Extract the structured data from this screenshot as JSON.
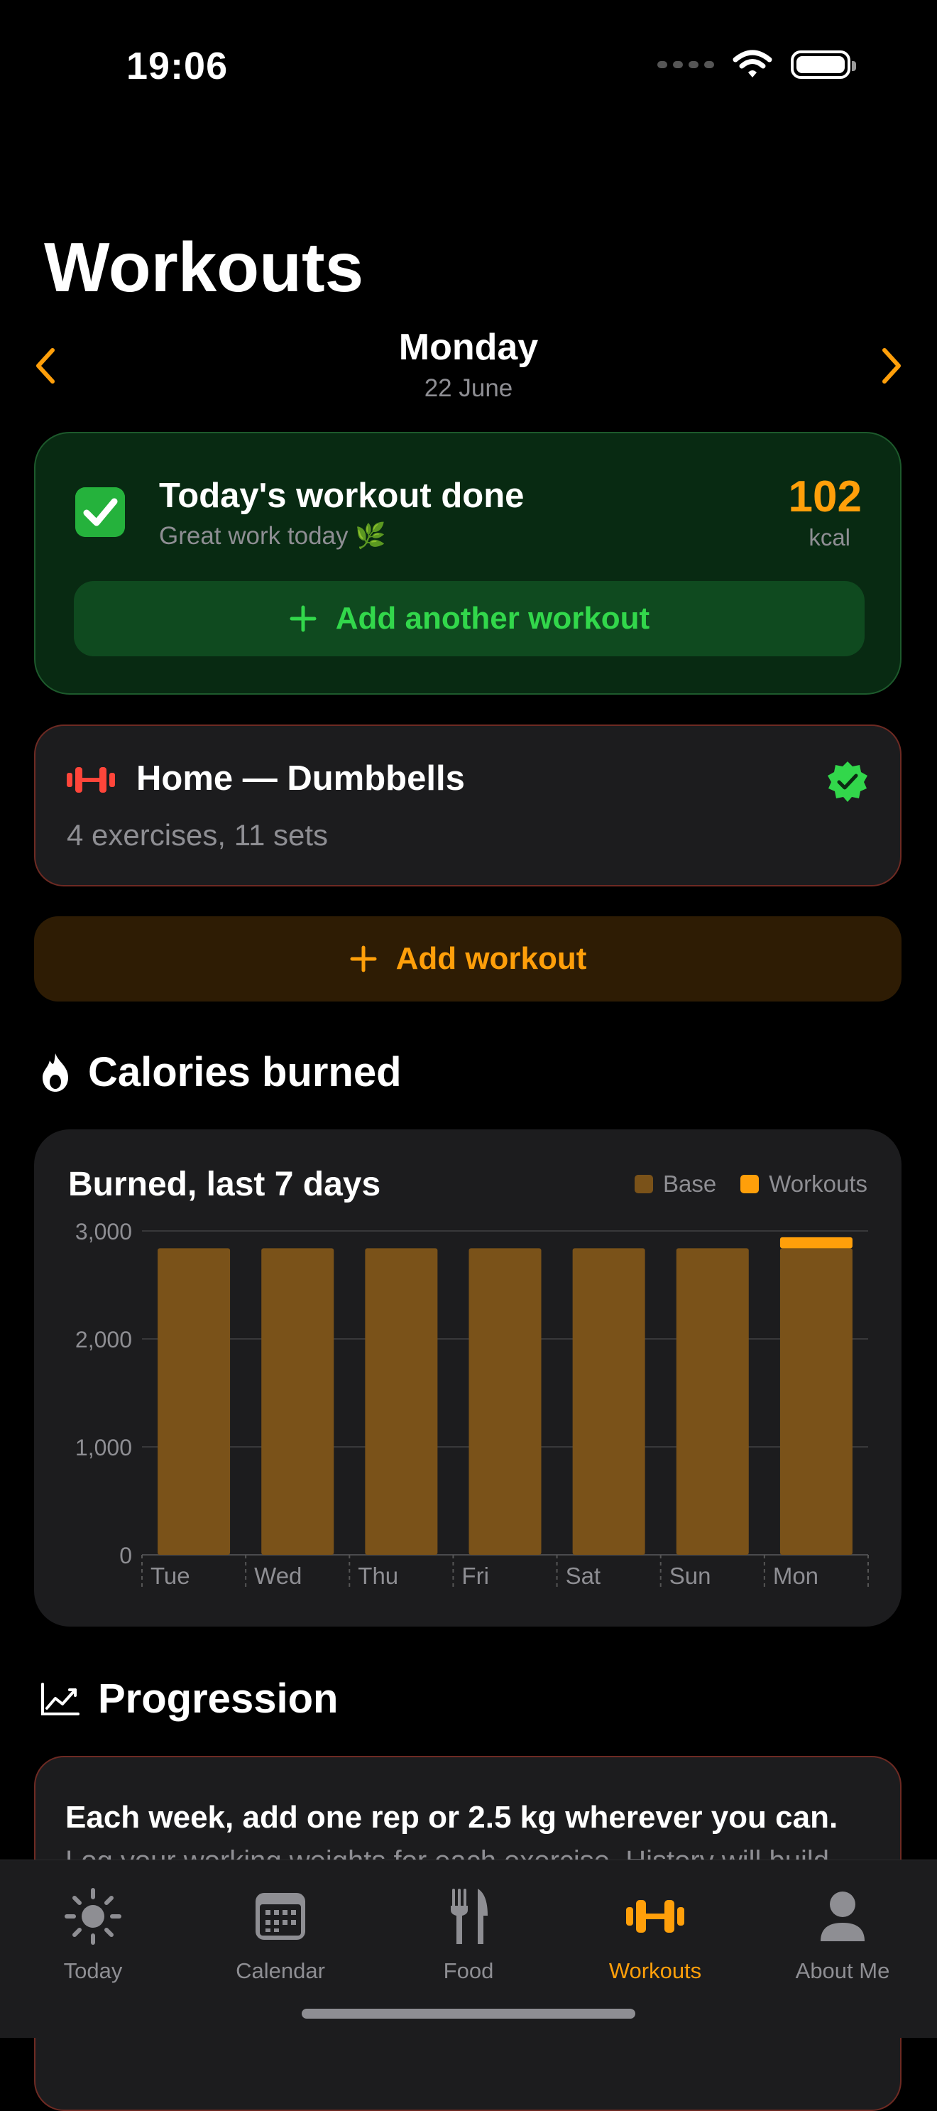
{
  "status": {
    "time": "19:06"
  },
  "header": {
    "title": "Workouts"
  },
  "date_nav": {
    "day": "Monday",
    "date": "22 June"
  },
  "done_card": {
    "title": "Today's workout done",
    "subtitle": "Great work today 🌿",
    "kcal_value": "102",
    "kcal_unit": "kcal",
    "add_another_label": "Add another workout"
  },
  "workout": {
    "title": "Home — Dumbbells",
    "summary": "4 exercises, 11 sets"
  },
  "add_workout_label": "Add workout",
  "calories_section": {
    "title": "Calories burned"
  },
  "chart_data": {
    "type": "bar",
    "title": "Burned, last 7 days",
    "categories": [
      "Tue",
      "Wed",
      "Thu",
      "Fri",
      "Sat",
      "Sun",
      "Mon"
    ],
    "series": [
      {
        "name": "Base",
        "values": [
          2840,
          2840,
          2840,
          2840,
          2840,
          2840,
          2840
        ],
        "color": "#7a5219"
      },
      {
        "name": "Workouts",
        "values": [
          0,
          0,
          0,
          0,
          0,
          0,
          102
        ],
        "color": "#ff9f0a"
      }
    ],
    "stacked": true,
    "ylim": [
      0,
      3000
    ],
    "yticks": [
      0,
      1000,
      2000,
      3000
    ],
    "ytick_labels": [
      "0",
      "1,000",
      "2,000",
      "3,000"
    ],
    "grid": true,
    "legend": "top-right"
  },
  "progression_section": {
    "title": "Progression"
  },
  "progression_card": {
    "title": "Each week, add one rep or 2.5 kg wherever you can.",
    "text": "Log your working weights for each exercise. History will build"
  },
  "tabs": [
    {
      "label": "Today",
      "icon": "sun-icon",
      "active": false
    },
    {
      "label": "Calendar",
      "icon": "calendar-icon",
      "active": false
    },
    {
      "label": "Food",
      "icon": "fork-knife-icon",
      "active": false
    },
    {
      "label": "Workouts",
      "icon": "dumbbell-icon",
      "active": true
    },
    {
      "label": "About Me",
      "icon": "person-icon",
      "active": false
    }
  ],
  "colors": {
    "accent": "#ff9f0a",
    "success": "#32d74b",
    "danger": "#ff453a"
  }
}
